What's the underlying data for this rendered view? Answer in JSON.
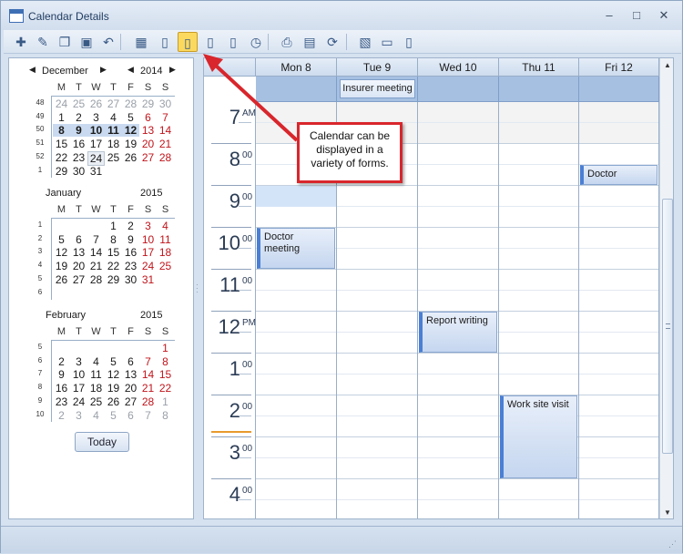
{
  "window": {
    "title": "Calendar Details",
    "controls": [
      "–",
      "□",
      "✕"
    ]
  },
  "toolbar": {
    "buttons": [
      {
        "name": "new-icon",
        "glyph": "✚"
      },
      {
        "name": "edit-icon",
        "glyph": "✎"
      },
      {
        "name": "copy-icon",
        "glyph": "❐"
      },
      {
        "name": "save-icon",
        "glyph": "▣"
      },
      {
        "name": "undo-icon",
        "glyph": "↶"
      },
      {
        "name": "month-view-icon",
        "glyph": "▦"
      },
      {
        "name": "day-view-icon",
        "glyph": "▯"
      },
      {
        "name": "work-week-view-icon",
        "glyph": "▯"
      },
      {
        "name": "week-view-icon",
        "glyph": "▯"
      },
      {
        "name": "timeline-view-icon",
        "glyph": "▯"
      },
      {
        "name": "clock-icon",
        "glyph": "◷"
      },
      {
        "name": "print-icon",
        "glyph": "⎙"
      },
      {
        "name": "export-icon",
        "glyph": "▤"
      },
      {
        "name": "refresh-icon",
        "glyph": "⟳"
      },
      {
        "name": "resource-icon",
        "glyph": "▧"
      },
      {
        "name": "horizontal-layout-icon",
        "glyph": "▭"
      },
      {
        "name": "vertical-layout-icon",
        "glyph": "▯"
      }
    ]
  },
  "navigator": {
    "months": [
      {
        "name": "December",
        "year": "2014",
        "dow": [
          "M",
          "T",
          "W",
          "T",
          "F",
          "S",
          "S"
        ],
        "weeks": [
          "48",
          "49",
          "50",
          "51",
          "52",
          "1"
        ],
        "rows": [
          [
            "24",
            "25",
            "26",
            "27",
            "28",
            "29",
            "30"
          ],
          [
            "1",
            "2",
            "3",
            "4",
            "5",
            "6",
            "7"
          ],
          [
            "8",
            "9",
            "10",
            "11",
            "12",
            "13",
            "14"
          ],
          [
            "15",
            "16",
            "17",
            "18",
            "19",
            "20",
            "21"
          ],
          [
            "22",
            "23",
            "24",
            "25",
            "26",
            "27",
            "28"
          ],
          [
            "29",
            "30",
            "31",
            "",
            "",
            "",
            ""
          ]
        ]
      },
      {
        "name": "January",
        "year": "2015",
        "dow": [
          "M",
          "T",
          "W",
          "T",
          "F",
          "S",
          "S"
        ],
        "weeks": [
          "1",
          "2",
          "3",
          "4",
          "5",
          "6"
        ],
        "rows": [
          [
            "",
            "",
            "",
            "1",
            "2",
            "3",
            "4"
          ],
          [
            "5",
            "6",
            "7",
            "8",
            "9",
            "10",
            "11"
          ],
          [
            "12",
            "13",
            "14",
            "15",
            "16",
            "17",
            "18"
          ],
          [
            "19",
            "20",
            "21",
            "22",
            "23",
            "24",
            "25"
          ],
          [
            "26",
            "27",
            "28",
            "29",
            "30",
            "31",
            ""
          ],
          [
            "",
            "",
            "",
            "",
            "",
            "",
            ""
          ]
        ]
      },
      {
        "name": "February",
        "year": "2015",
        "dow": [
          "M",
          "T",
          "W",
          "T",
          "F",
          "S",
          "S"
        ],
        "weeks": [
          "5",
          "6",
          "7",
          "8",
          "9",
          "10"
        ],
        "rows": [
          [
            "",
            "",
            "",
            "",
            "",
            "",
            "1"
          ],
          [
            "2",
            "3",
            "4",
            "5",
            "6",
            "7",
            "8"
          ],
          [
            "9",
            "10",
            "11",
            "12",
            "13",
            "14",
            "15"
          ],
          [
            "16",
            "17",
            "18",
            "19",
            "20",
            "21",
            "22"
          ],
          [
            "23",
            "24",
            "25",
            "26",
            "27",
            "28",
            "1"
          ],
          [
            "2",
            "3",
            "4",
            "5",
            "6",
            "7",
            "8"
          ]
        ]
      }
    ],
    "today_label": "Today"
  },
  "days": [
    {
      "label": "Mon 8"
    },
    {
      "label": "Tue 9"
    },
    {
      "label": "Wed 10"
    },
    {
      "label": "Thu 11"
    },
    {
      "label": "Fri 12"
    }
  ],
  "hours": [
    {
      "big": "7",
      "small": "AM"
    },
    {
      "big": "8",
      "small": "00"
    },
    {
      "big": "9",
      "small": "00"
    },
    {
      "big": "10",
      "small": "00"
    },
    {
      "big": "11",
      "small": "00"
    },
    {
      "big": "12",
      "small": "PM"
    },
    {
      "big": "1",
      "small": "00"
    },
    {
      "big": "2",
      "small": "00"
    },
    {
      "big": "3",
      "small": "00"
    },
    {
      "big": "4",
      "small": "00"
    }
  ],
  "all_day_events": [
    {
      "title": "Insurer meeting",
      "day": 1
    }
  ],
  "appointments": [
    {
      "title": "Doctor",
      "day": 4,
      "start": "8:30",
      "end": "9:00"
    },
    {
      "title": "Doctor meeting",
      "day": 0,
      "start": "10:00",
      "end": "11:00"
    },
    {
      "title": "Report writing",
      "day": 2,
      "start": "12:00",
      "end": "13:00"
    },
    {
      "title": "Work site visit",
      "day": 3,
      "start": "14:00",
      "end": "16:00"
    }
  ],
  "callout": {
    "text": "Calendar can be displayed in a variety of forms."
  },
  "colors": {
    "accent": "#4a7fd4",
    "all_day_band": "#a6c0e2",
    "weekend": "#c0141b",
    "callout_red": "#d8262c",
    "now_line": "#e89a2d"
  }
}
